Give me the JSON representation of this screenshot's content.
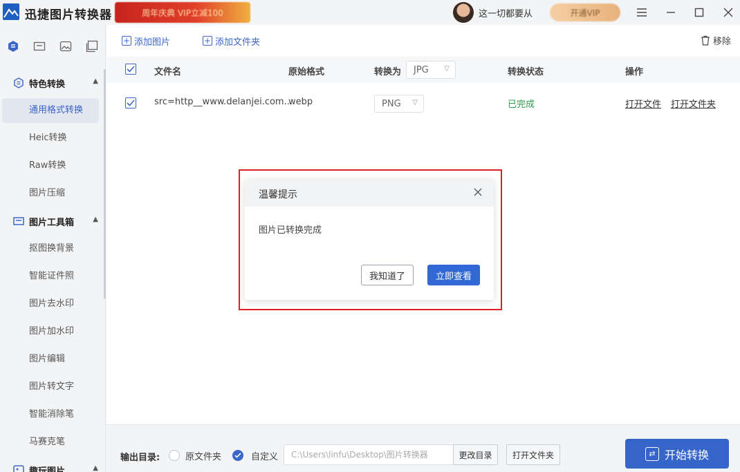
{
  "app": {
    "title": "迅捷图片转换器",
    "promo_text": "周年庆典 VIP立减100",
    "user_name": "这一切都要从",
    "vip_label": "开通VIP",
    "window_controls": [
      "menu-icon",
      "minimize-icon",
      "maximize-icon",
      "close-icon"
    ]
  },
  "sidebar": {
    "top_icons": [
      "convert-icon",
      "toolbox-icon",
      "image-icon",
      "gallery-icon"
    ],
    "groups": [
      {
        "label": "特色转换",
        "icon": "convert-icon",
        "caret": "^"
      },
      {
        "label": "图片工具箱",
        "icon": "toolbox-icon",
        "caret": "^"
      },
      {
        "label": "趣玩图片",
        "icon": "fun-image-icon",
        "caret": "^"
      }
    ],
    "items": [
      {
        "label": "通用格式转换",
        "active": true
      },
      {
        "label": "Heic转换"
      },
      {
        "label": "Raw转换"
      },
      {
        "label": "图片压缩"
      },
      {
        "label": "抠图换背景"
      },
      {
        "label": "智能证件照"
      },
      {
        "label": "图片去水印"
      },
      {
        "label": "图片加水印"
      },
      {
        "label": "图片编辑"
      },
      {
        "label": "图片转文字"
      },
      {
        "label": "智能消除笔"
      },
      {
        "label": "马赛克笔"
      }
    ]
  },
  "toolbar": {
    "add_image": "添加图片",
    "add_folder": "添加文件夹",
    "remove": "移除"
  },
  "table": {
    "headers": {
      "filename": "文件名",
      "original_format": "原始格式",
      "convert_to": "转换为",
      "status": "转换状态",
      "actions": "操作"
    },
    "header_format_select": "JPG",
    "rows": [
      {
        "filename": "src=http__www.delanjei.com...",
        "original_format": "webp",
        "target_format": "PNG",
        "status": "已完成",
        "open_file": "打开文件",
        "open_folder": "打开文件夹"
      }
    ]
  },
  "bottom": {
    "output_label": "输出目录:",
    "option_original": "原文件夹",
    "option_custom": "自定义",
    "path": "C:\\Users\\linfu\\Desktop\\图片转换器",
    "change_dir": "更改目录",
    "open_folder": "打开文件夹",
    "start": "开始转换"
  },
  "dialog": {
    "title": "温馨提示",
    "message": "图片已转换完成",
    "btn_ok": "我知道了",
    "btn_view": "立即查看"
  },
  "colors": {
    "accent": "#3b67c9",
    "primary_button": "#3268d6",
    "success": "#2a9d4a",
    "highlight_border": "#e02020"
  }
}
